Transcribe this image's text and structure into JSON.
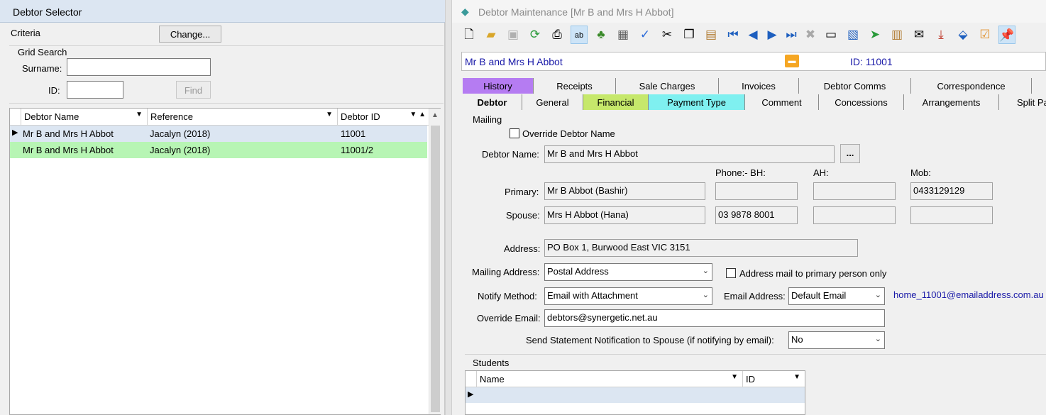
{
  "left": {
    "title": "Debtor Selector",
    "criteria_label": "Criteria",
    "change_button": "Change...",
    "grid_search_label": "Grid Search",
    "surname_label": "Surname:",
    "surname_value": "",
    "id_label": "ID:",
    "id_value": "",
    "find_button": "Find",
    "grid": {
      "columns": [
        "Debtor Name",
        "Reference",
        "Debtor ID"
      ],
      "rows": [
        {
          "name": "Mr B and Mrs H Abbot",
          "reference": "Jacalyn (2018)",
          "id": "11001"
        },
        {
          "name": "Mr B and Mrs H Abbot",
          "reference": "Jacalyn (2018)",
          "id": "11001/2"
        }
      ],
      "row_colors": [
        "#dce6f2",
        "#b7f5b4"
      ]
    }
  },
  "right": {
    "title": "Debtor Maintenance  [Mr B and Mrs H Abbot]",
    "name_bar": {
      "name": "Mr B and Mrs H Abbot",
      "id": "ID: 11001"
    },
    "toolbar_icons": [
      "new-icon",
      "open-icon",
      "save-icon",
      "refresh-icon",
      "print-icon",
      "text-field-icon",
      "tree-icon",
      "calculator-icon",
      "spellcheck-icon",
      "cut-icon",
      "copy-icon",
      "paste-icon",
      "first-record-icon",
      "previous-record-icon",
      "next-record-icon",
      "last-record-icon",
      "delete-icon",
      "card-icon",
      "export-icon",
      "send-icon",
      "clipboard-icon",
      "mail-icon",
      "download-icon",
      "tag-icon",
      "checklist-icon",
      "pin-icon"
    ],
    "tabs_row1": [
      "History",
      "Receipts",
      "Sale Charges",
      "Invoices",
      "Debtor Comms",
      "Correspondence"
    ],
    "tabs_row2": [
      "Debtor",
      "General",
      "Financial",
      "Payment Type",
      "Comment",
      "Concessions",
      "Arrangements",
      "Split Pa"
    ],
    "tab_colors": {
      "history": "#b57cf2",
      "financial": "#c6e86b",
      "payment_type": "#7ff0f0"
    },
    "mailing": {
      "section_label": "Mailing",
      "override_label": "Override Debtor Name",
      "debtor_name_label": "Debtor Name:",
      "debtor_name": "Mr B and Mrs H Abbot",
      "ellipsis": "...",
      "phone_bh_label": "Phone:-  BH:",
      "ah_label": "AH:",
      "mob_label": "Mob:",
      "primary_label": "Primary:",
      "primary_name": "Mr B Abbot (Bashir)",
      "primary_bh": "",
      "primary_ah": "",
      "primary_mob": "0433129129",
      "spouse_label": "Spouse:",
      "spouse_name": "Mrs H Abbot (Hana)",
      "spouse_bh": "03 9878 8001",
      "spouse_ah": "",
      "spouse_mob": "",
      "address_label": "Address:",
      "address": "PO Box 1, Burwood East VIC 3151",
      "mailing_address_label": "Mailing Address:",
      "mailing_address": "Postal Address",
      "address_primary_only_label": "Address mail to primary person only",
      "notify_method_label": "Notify Method:",
      "notify_method": "Email with Attachment",
      "email_address_label": "Email Address:",
      "email_address": "Default Email",
      "email_link": "home_11001@emailaddress.com.au",
      "override_email_label": "Override Email:",
      "override_email": "debtors@synergetic.net.au",
      "send_stmt_label": "Send Statement Notification to Spouse (if notifying by email):",
      "send_stmt_value": "No"
    },
    "students": {
      "section_label": "Students",
      "columns": [
        "Name",
        "ID"
      ]
    }
  }
}
